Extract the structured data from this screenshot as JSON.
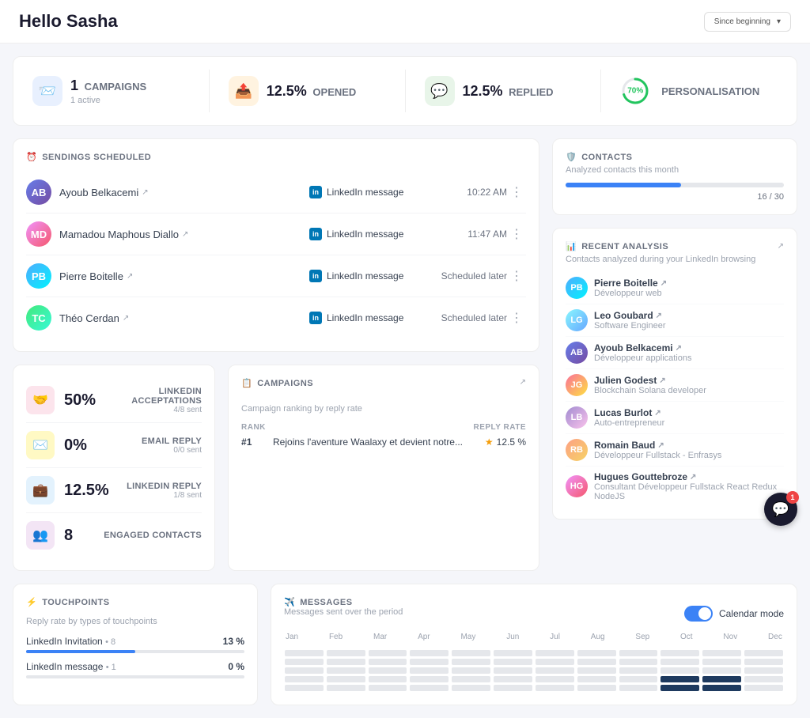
{
  "header": {
    "title": "Hello Sasha",
    "dateFilter": "Since beginning"
  },
  "stats": [
    {
      "id": "campaigns",
      "iconColor": "blue",
      "iconSymbol": "📨",
      "value": "1",
      "label": "CAMPAIGNS",
      "sub": "1 active"
    },
    {
      "id": "opened",
      "iconColor": "orange",
      "iconSymbol": "📤",
      "value": "12.5%",
      "label": "OPENED",
      "sub": ""
    },
    {
      "id": "replied",
      "iconColor": "green",
      "iconSymbol": "💬",
      "value": "12.5%",
      "label": "REPLIED",
      "sub": ""
    },
    {
      "id": "personalisation",
      "iconColor": "circle",
      "value": "70%",
      "label": "PERSONALISATION",
      "sub": "",
      "progress": 70
    }
  ],
  "sendings": {
    "sectionTitle": "SENDINGS SCHEDULED",
    "rows": [
      {
        "name": "Ayoub Belkacemi",
        "channel": "LinkedIn message",
        "time": "10:22 AM",
        "avatarClass": "av-1",
        "avatarText": "AB"
      },
      {
        "name": "Mamadou Maphous Diallo",
        "channel": "LinkedIn message",
        "time": "11:47 AM",
        "avatarClass": "av-2",
        "avatarText": "MD"
      },
      {
        "name": "Pierre Boitelle",
        "channel": "LinkedIn message",
        "time": "Scheduled later",
        "avatarClass": "av-3",
        "avatarText": "PB"
      },
      {
        "name": "Théo Cerdan",
        "channel": "LinkedIn message",
        "time": "Scheduled later",
        "avatarClass": "av-4",
        "avatarText": "TC"
      }
    ]
  },
  "metrics": [
    {
      "id": "linkedin-acceptations",
      "iconColor": "pink",
      "iconSymbol": "🤝",
      "value": "50%",
      "label": "LINKEDIN ACCEPTATIONS",
      "sub": "4/8 sent"
    },
    {
      "id": "email-reply",
      "iconColor": "yellow",
      "iconSymbol": "✉️",
      "value": "0%",
      "label": "EMAIL REPLY",
      "sub": "0/0 sent"
    },
    {
      "id": "linkedin-reply",
      "iconColor": "blue",
      "iconSymbol": "💼",
      "value": "12.5%",
      "label": "LINKEDIN REPLY",
      "sub": "1/8 sent"
    },
    {
      "id": "engaged-contacts",
      "iconColor": "purple",
      "iconSymbol": "👥",
      "value": "8",
      "label": "ENGAGED CONTACTS",
      "sub": ""
    }
  ],
  "campaigns": {
    "sectionTitle": "CAMPAIGNS",
    "sub": "Campaign ranking by reply rate",
    "colRank": "RANK",
    "colRate": "REPLY RATE",
    "rows": [
      {
        "rank": "#1",
        "name": "Rejoins l'aventure Waalaxy et devient notre...",
        "rate": "12.5 %"
      }
    ]
  },
  "contacts": {
    "sectionTitle": "CONTACTS",
    "sub": "Analyzed contacts this month",
    "current": 16,
    "total": 30,
    "progressLabel": "16 / 30",
    "progressPercent": 53
  },
  "recentAnalysis": {
    "sectionTitle": "RECENT ANALYSIS",
    "sub": "Contacts analyzed during your LinkedIn browsing",
    "contacts": [
      {
        "name": "Pierre Boitelle",
        "title": "Développeur web",
        "avatarClass": "av-3",
        "avatarText": "PB"
      },
      {
        "name": "Leo Goubard",
        "title": "Software Engineer",
        "avatarClass": "av-8",
        "avatarText": "LG"
      },
      {
        "name": "Ayoub Belkacemi",
        "title": "Développeur applications",
        "avatarClass": "av-1",
        "avatarText": "AB"
      },
      {
        "name": "Julien Godest",
        "title": "Blockchain Solana developer",
        "avatarClass": "av-5",
        "avatarText": "JG"
      },
      {
        "name": "Lucas Burlot",
        "title": "Auto-entrepreneur",
        "avatarClass": "av-6",
        "avatarText": "LB"
      },
      {
        "name": "Romain Baud",
        "title": "Développeur Fullstack - Enfrasys",
        "avatarClass": "av-7",
        "avatarText": "RB"
      },
      {
        "name": "Hugues Gouttebroze",
        "title": "Consultant Développeur Fullstack React Redux NodeJS",
        "avatarClass": "av-2",
        "avatarText": "HG"
      }
    ]
  },
  "touchpoints": {
    "sectionTitle": "TOUCHPOINTS",
    "sub": "Reply rate by types of touchpoints",
    "items": [
      {
        "name": "LinkedIn Invitation",
        "count": "8",
        "rate": "13 %",
        "barWidth": 50,
        "barClass": "blue"
      },
      {
        "name": "LinkedIn message",
        "count": "1",
        "rate": "0 %",
        "barWidth": 0,
        "barClass": "gray"
      }
    ]
  },
  "messages": {
    "sectionTitle": "MESSAGES",
    "sub": "Messages sent over the period",
    "calendarModeLabel": "Calendar mode",
    "months": [
      "Jan",
      "Feb",
      "Mar",
      "Apr",
      "May",
      "Jun",
      "Jul",
      "Aug",
      "Sep",
      "Oct",
      "Nov",
      "Dec"
    ],
    "activeMonths": [
      9,
      10
    ]
  },
  "chat": {
    "badge": "1"
  }
}
